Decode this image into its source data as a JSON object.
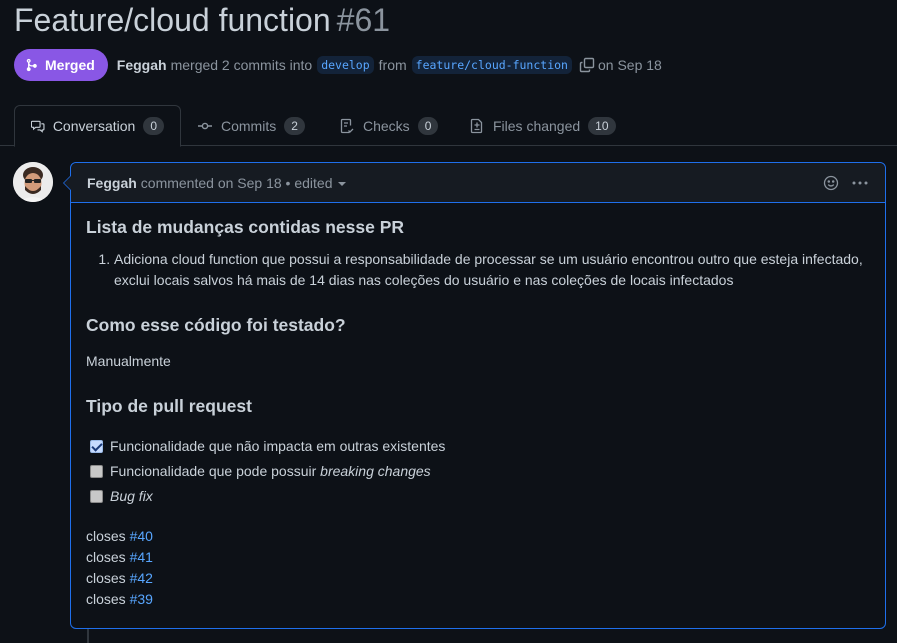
{
  "pr": {
    "title": "Feature/cloud function",
    "number": "#61",
    "state": "Merged",
    "author": "Feggah",
    "merge_text": "merged 2 commits into",
    "base_branch": "develop",
    "from_text": "from",
    "head_branch": "feature/cloud-function",
    "date_text": "on Sep 18"
  },
  "tabs": [
    {
      "label": "Conversation",
      "count": "0",
      "icon": "comment-discussion-icon"
    },
    {
      "label": "Commits",
      "count": "2",
      "icon": "git-commit-icon"
    },
    {
      "label": "Checks",
      "count": "0",
      "icon": "checklist-icon"
    },
    {
      "label": "Files changed",
      "count": "10",
      "icon": "file-diff-icon"
    }
  ],
  "comment": {
    "author": "Feggah",
    "meta": "commented on Sep 18 • edited",
    "heading_changes": "Lista de mudanças contidas nesse PR",
    "changes": [
      "Adiciona cloud function que possui a responsabilidade de processar se um usuário encontrou outro que esteja infectado, exclui locais salvos há mais de 14 dias nas coleções do usuário e nas coleções de locais infectados"
    ],
    "heading_tested": "Como esse código foi testado?",
    "tested": "Manualmente",
    "heading_type": "Tipo de pull request",
    "tasks": [
      {
        "checked": true,
        "text": "Funcionalidade que não impacta em outras existentes",
        "emphasis": ""
      },
      {
        "checked": false,
        "text": "Funcionalidade que pode possuir ",
        "emphasis": "breaking changes"
      },
      {
        "checked": false,
        "text": "",
        "emphasis": "Bug fix"
      }
    ],
    "closes_word": "closes",
    "closes": [
      "#40",
      "#41",
      "#42",
      "#39"
    ]
  },
  "colors": {
    "merged": "#8957e5",
    "link": "#58a6ff",
    "accent_border": "#1f6feb",
    "background": "#0d1117"
  }
}
